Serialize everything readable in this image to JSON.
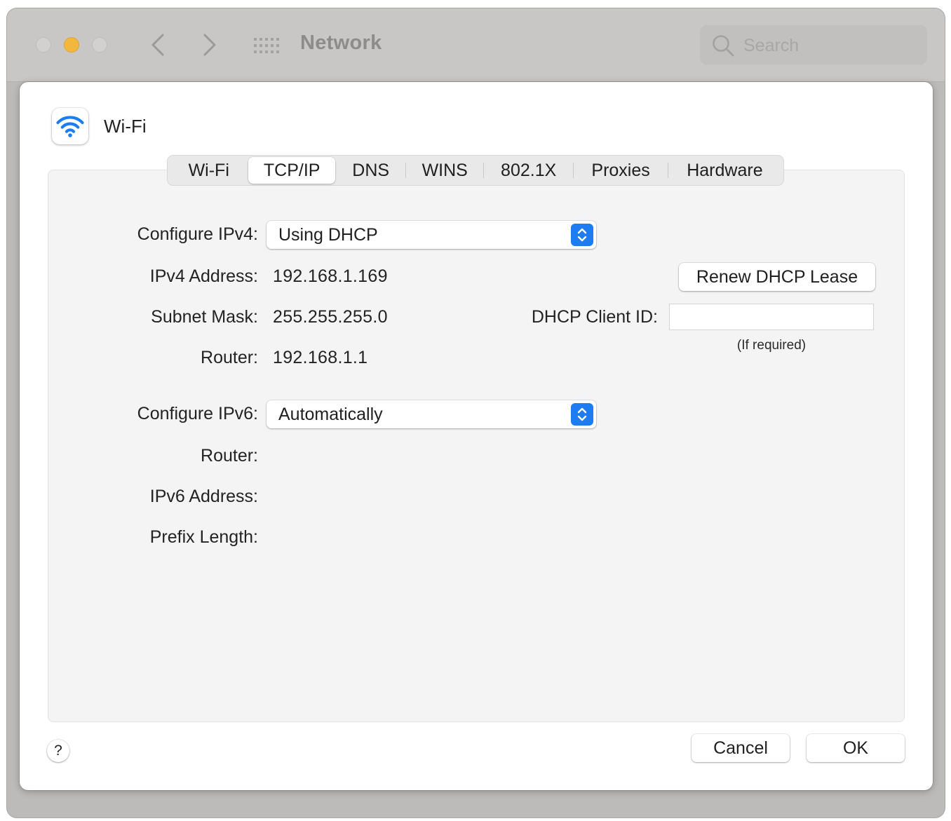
{
  "window": {
    "title": "Network",
    "search_placeholder": "Search"
  },
  "service": {
    "name": "Wi-Fi",
    "icon": "wifi-icon",
    "accent_color": "#1e7cf2"
  },
  "tabs": [
    {
      "label": "Wi-Fi",
      "active": false
    },
    {
      "label": "TCP/IP",
      "active": true
    },
    {
      "label": "DNS",
      "active": false
    },
    {
      "label": "WINS",
      "active": false
    },
    {
      "label": "802.1X",
      "active": false
    },
    {
      "label": "Proxies",
      "active": false
    },
    {
      "label": "Hardware",
      "active": false
    }
  ],
  "ipv4": {
    "configure_label": "Configure IPv4:",
    "configure_value": "Using DHCP",
    "address_label": "IPv4 Address:",
    "address_value": "192.168.1.169",
    "subnet_label": "Subnet Mask:",
    "subnet_value": "255.255.255.0",
    "router_label": "Router:",
    "router_value": "192.168.1.1"
  },
  "dhcp": {
    "renew_label": "Renew DHCP Lease",
    "client_id_label": "DHCP Client ID:",
    "client_id_value": "",
    "client_id_hint": "(If required)"
  },
  "ipv6": {
    "configure_label": "Configure IPv6:",
    "configure_value": "Automatically",
    "router_label": "Router:",
    "address_label": "IPv6 Address:",
    "prefix_label": "Prefix Length:"
  },
  "footer": {
    "help_label": "?",
    "cancel_label": "Cancel",
    "ok_label": "OK"
  }
}
